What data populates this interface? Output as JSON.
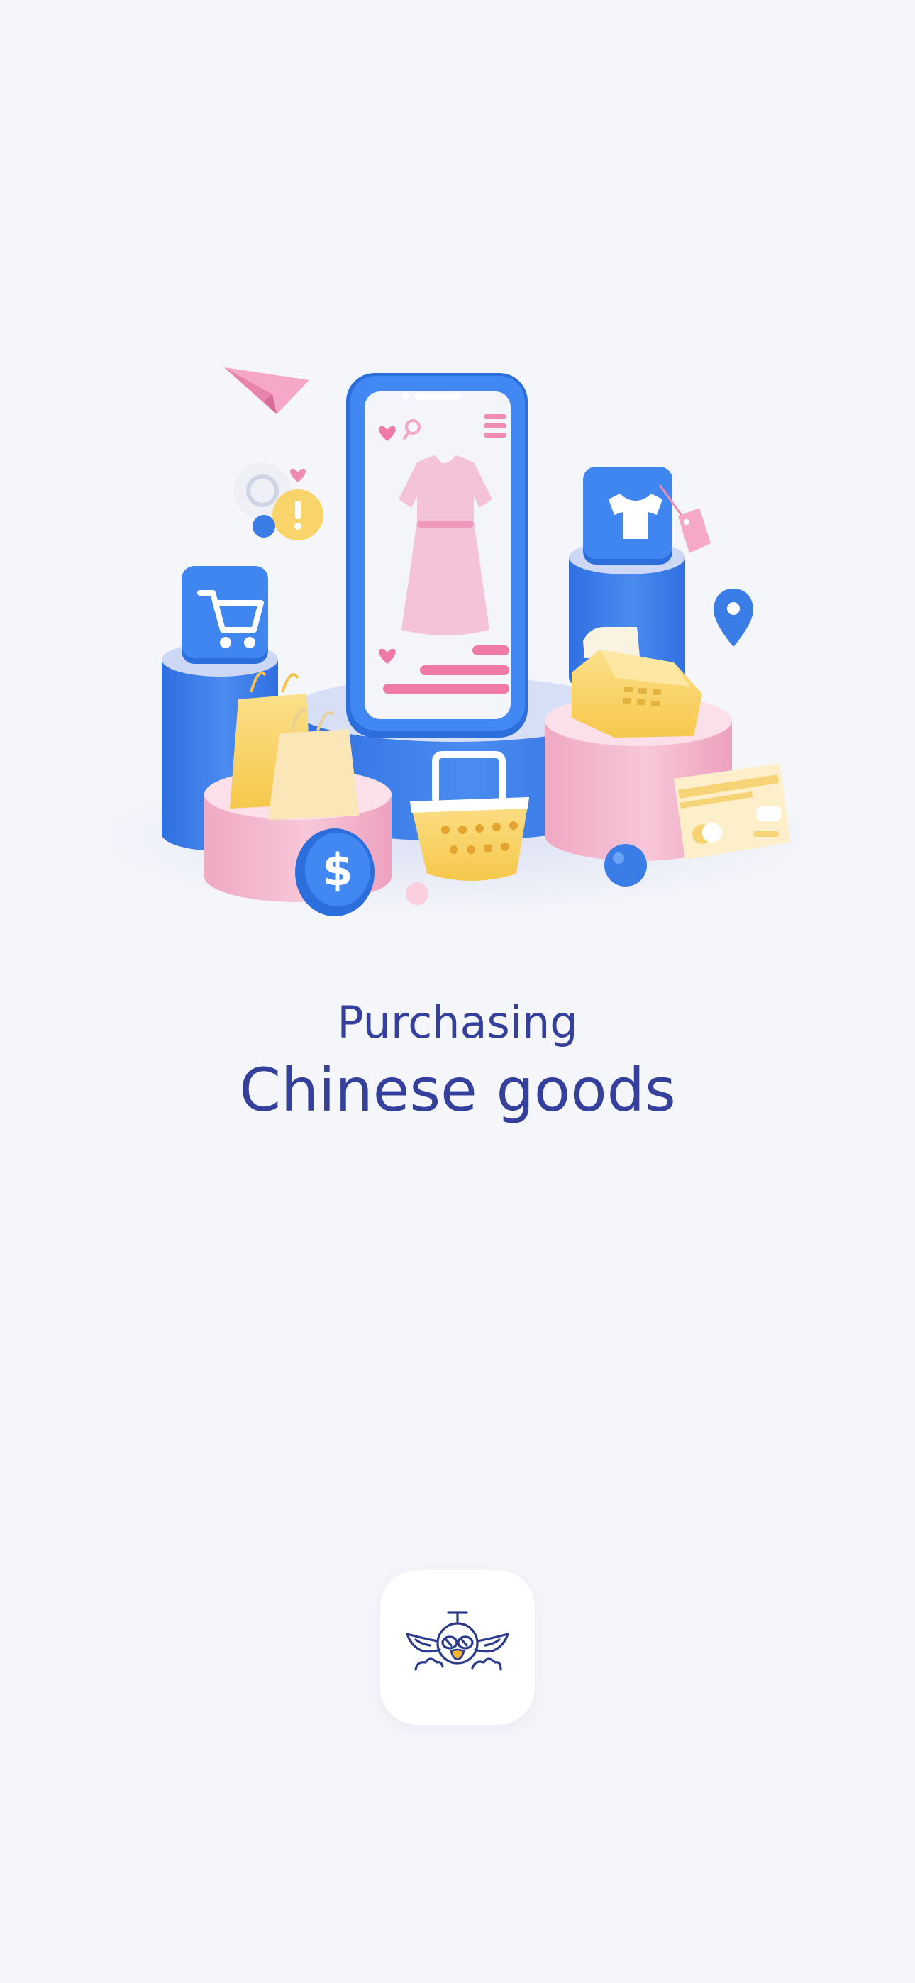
{
  "splash": {
    "title_small": "Purchasing",
    "title_large": "Chinese goods",
    "illustration_icon": "shopping-scene-illustration",
    "logo_icon": "bird-airplane-logo-icon"
  },
  "colors": {
    "background": "#f5f6fa",
    "title_text": "#34409b",
    "accent_blue": "#3b7de6",
    "accent_pink": "#f3b7cd",
    "accent_yellow": "#f9d46b",
    "logo_stroke": "#2b3a8c",
    "logo_beak": "#f4b52e"
  }
}
